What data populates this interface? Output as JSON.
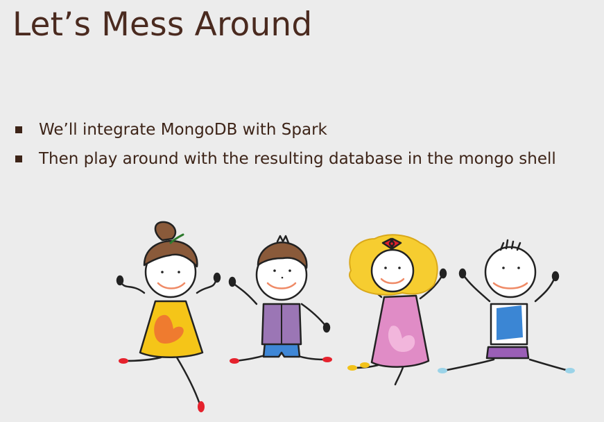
{
  "slide": {
    "title": "Let’s Mess Around",
    "bullets": [
      "We’ll integrate MongoDB with Spark",
      "Then play around with the resulting database in the mongo shell"
    ]
  },
  "illustration": {
    "icon": "kids-jumping-illustration",
    "colors": {
      "girl_dress": "#f5c518",
      "girl_dress_patch": "#ef7b2f",
      "boy_shirt": "#9b76b5",
      "boy_shorts": "#3f87d6",
      "blonde_dress": "#e08cc6",
      "bow": "#e2202b",
      "kid4_shirt": "#3b86d4",
      "kid4_shorts": "#9a5fb6",
      "hair_brown": "#8a5a3a",
      "hair_blonde": "#f6cd30",
      "skin": "#ffffff",
      "outline": "#222222",
      "mouth": "#ef8a66",
      "shoe_red": "#e5222d",
      "shoe_yellow": "#f2c21a",
      "shoe_blue": "#9bd3e8"
    }
  }
}
